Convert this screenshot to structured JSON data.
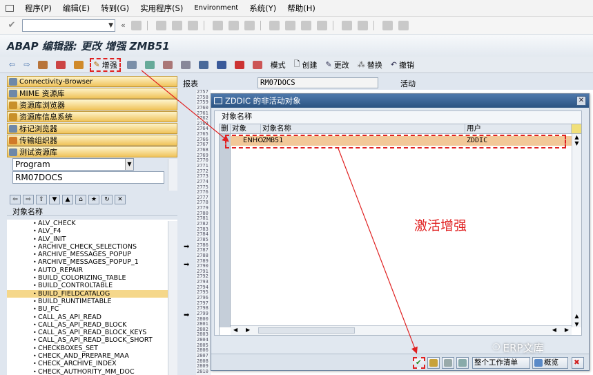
{
  "menubar": {
    "items": [
      "程序(P)",
      "编辑(E)",
      "转到(G)",
      "实用程序(S)",
      "Environment",
      "系统(Y)",
      "帮助(H)"
    ]
  },
  "window": {
    "title": "ABAP 编辑器: 更改 增强 ZMB51"
  },
  "apptoolbar": {
    "enhance": "增强",
    "mode": "模式",
    "create": "创建",
    "change": "更改",
    "replace": "替换",
    "undo": "撤销"
  },
  "leftpanel": {
    "buttons": [
      "Connectivity-Browser",
      "MIME 资源库",
      "资源库浏览器",
      "资源库信息系统",
      "标记浏览器",
      "传输组织器",
      "测试资源库"
    ],
    "object_type": "Program",
    "object_name": "RM07DOCS",
    "list_header": "对象名称",
    "items": [
      "ALV_CHECK",
      "ALV_F4",
      "ALV_INIT",
      "ARCHIVE_CHECK_SELECTIONS",
      "ARCHIVE_MESSAGES_POPUP",
      "ARCHIVE_MESSAGES_POPUP_1",
      "AUTO_REPAIR",
      "BUILD_COLORIZING_TABLE",
      "BUILD_CONTROLTABLE",
      "BUILD_FIELDCATALOG",
      "BUILD_RUNTIMETABLE",
      "BU_FC",
      "CALL_AS_API_READ",
      "CALL_AS_API_READ_BLOCK",
      "CALL_AS_API_READ_BLOCK_KEYS",
      "CALL_AS_API_READ_BLOCK_SHORT",
      "CHECKBOXES_SET",
      "CHECK_AND_PREPARE_MAA",
      "CHECK_ARCHIVE_INDEX",
      "CHECK_AUTHORITY_MM_DOC"
    ],
    "selected_index": 9
  },
  "editor": {
    "report_label": "报表",
    "report_value": "RM07DOCS",
    "status": "活动",
    "line_numbers": [
      "2757",
      "2758",
      "2759",
      "2760",
      "2761",
      "2762",
      "2763",
      "2764",
      "2765",
      "2766",
      "2767",
      "2768",
      "2769",
      "2770",
      "2771",
      "2772",
      "2773",
      "2774",
      "2775",
      "2776",
      "2777",
      "2778",
      "2779",
      "2780",
      "2781",
      "2782",
      "2783",
      "2784",
      "2785",
      "2786",
      "2787",
      "2788",
      "2789",
      "2790",
      "2791",
      "2792",
      "2793",
      "2794",
      "2795",
      "2796",
      "2797",
      "2798",
      "2799",
      "2800",
      "2801",
      "2802",
      "2803",
      "2804",
      "2805",
      "2806",
      "2807",
      "2808",
      "2809",
      "2810"
    ]
  },
  "dialog": {
    "title": "ZDDIC 的非活动对象",
    "grid_title": "对象名称",
    "columns": [
      "删",
      "对象",
      "对象名称",
      "用户"
    ],
    "row": {
      "type": "ENHO",
      "name": "ZMB51",
      "user": "ZDDIC"
    },
    "footer": {
      "worklist": "整个工作清单",
      "overview": "概览"
    }
  },
  "annotation": "激活增强",
  "watermark": "ERP文库",
  "colors": {
    "title_bar": "#2c5482",
    "highlight_row": "#f2c898",
    "annotation": "#e02020"
  }
}
